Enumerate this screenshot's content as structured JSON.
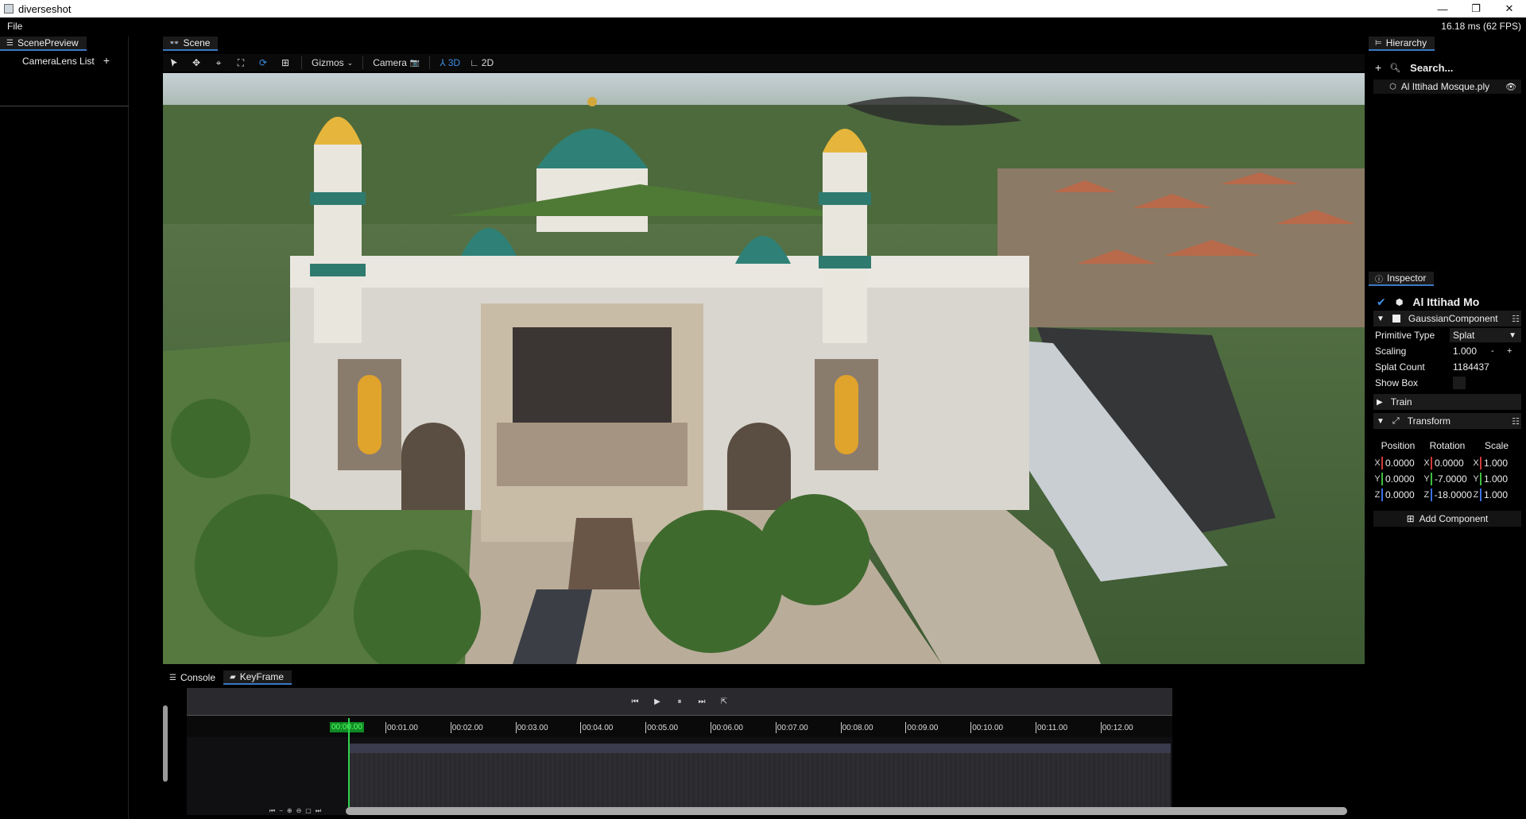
{
  "window": {
    "title": "diverseshot",
    "min": "—",
    "restore": "❐",
    "close": "✕"
  },
  "menubar": {
    "file": "File",
    "fps": "16.18 ms (62 FPS)"
  },
  "left_panel": {
    "tab": "ScenePreview",
    "lens_list_label": "CameraLens List",
    "add": "+"
  },
  "scene": {
    "tab": "Scene",
    "toolbar": {
      "gizmos": "Gizmos",
      "camera": "Camera",
      "mode3d": "3D",
      "mode2d": "2D"
    }
  },
  "bottom": {
    "tabs": [
      "Console",
      "KeyFrame"
    ],
    "current_time": "00:00.00",
    "ruler": [
      "00:01.00",
      "00:02.00",
      "00:03.00",
      "00:04.00",
      "00:05.00",
      "00:06.00",
      "00:07.00",
      "00:08.00",
      "00:09.00",
      "00:10.00",
      "00:11.00",
      "00:12.00"
    ]
  },
  "hierarchy": {
    "tab": "Hierarchy",
    "add": "+",
    "search": "Search...",
    "item": "Al Ittihad Mosque.ply"
  },
  "inspector": {
    "tab": "Inspector",
    "object_name": "Al Ittihad Mo",
    "gaussian": {
      "label": "GaussianComponent",
      "primitive_type_label": "Primitive Type",
      "primitive_type_value": "Splat",
      "scaling_label": "Scaling",
      "scaling_value": "1.000",
      "minus": "-",
      "plus": "+",
      "splat_count_label": "Splat Count",
      "splat_count_value": "1184437",
      "show_box_label": "Show Box"
    },
    "train_label": "Train",
    "transform": {
      "label": "Transform",
      "headers": [
        "Position",
        "Rotation",
        "Scale"
      ],
      "rows": [
        {
          "axis": "X",
          "position": "0.0000",
          "rotation": "0.0000",
          "scale": "1.000"
        },
        {
          "axis": "Y",
          "position": "0.0000",
          "rotation": "-7.0000",
          "scale": "1.000"
        },
        {
          "axis": "Z",
          "position": "0.0000",
          "rotation": "-18.0000",
          "scale": "1.000"
        }
      ]
    },
    "add_component": "Add Component"
  },
  "colors": {
    "accent": "#3b8fe5",
    "playhead": "#2fd44a",
    "axis_x": "#d23a3a",
    "axis_y": "#3fbf3f",
    "axis_z": "#3b6fe5"
  }
}
